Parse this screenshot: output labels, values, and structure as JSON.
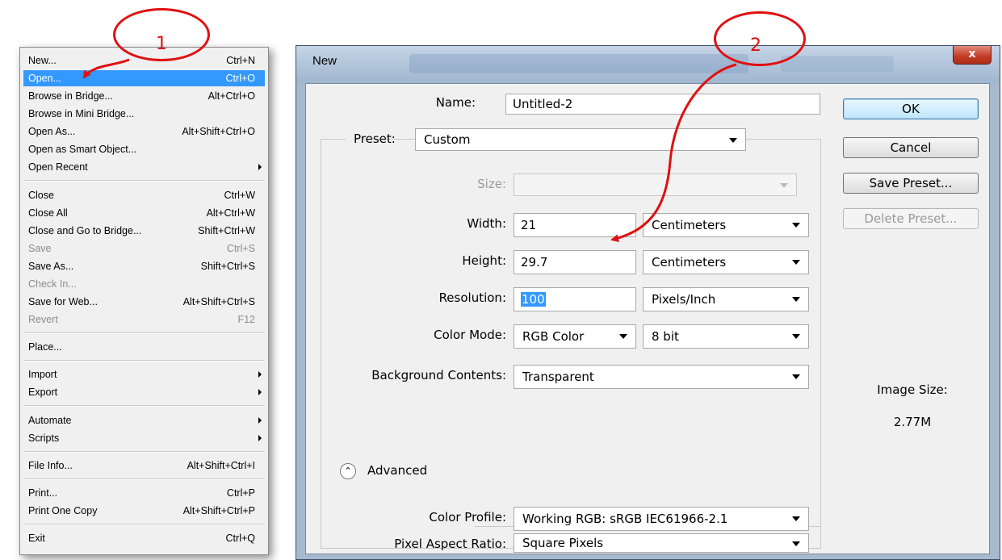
{
  "annotations": {
    "step1": "1",
    "step2": "2"
  },
  "file_menu": {
    "items": [
      {
        "label": "New...",
        "shortcut": "Ctrl+N"
      },
      {
        "label": "Open...",
        "shortcut": "Ctrl+O"
      },
      {
        "label": "Browse in Bridge...",
        "shortcut": "Alt+Ctrl+O"
      },
      {
        "label": "Browse in Mini Bridge...",
        "shortcut": ""
      },
      {
        "label": "Open As...",
        "shortcut": "Alt+Shift+Ctrl+O"
      },
      {
        "label": "Open as Smart Object...",
        "shortcut": ""
      },
      {
        "label": "Open Recent",
        "shortcut": ""
      },
      {
        "label": "Close",
        "shortcut": "Ctrl+W"
      },
      {
        "label": "Close All",
        "shortcut": "Alt+Ctrl+W"
      },
      {
        "label": "Close and Go to Bridge...",
        "shortcut": "Shift+Ctrl+W"
      },
      {
        "label": "Save",
        "shortcut": "Ctrl+S"
      },
      {
        "label": "Save As...",
        "shortcut": "Shift+Ctrl+S"
      },
      {
        "label": "Check In...",
        "shortcut": ""
      },
      {
        "label": "Save for Web...",
        "shortcut": "Alt+Shift+Ctrl+S"
      },
      {
        "label": "Revert",
        "shortcut": "F12"
      },
      {
        "label": "Place...",
        "shortcut": ""
      },
      {
        "label": "Import",
        "shortcut": ""
      },
      {
        "label": "Export",
        "shortcut": ""
      },
      {
        "label": "Automate",
        "shortcut": ""
      },
      {
        "label": "Scripts",
        "shortcut": ""
      },
      {
        "label": "File Info...",
        "shortcut": "Alt+Shift+Ctrl+I"
      },
      {
        "label": "Print...",
        "shortcut": "Ctrl+P"
      },
      {
        "label": "Print One Copy",
        "shortcut": "Alt+Shift+Ctrl+P"
      },
      {
        "label": "Exit",
        "shortcut": "Ctrl+Q"
      }
    ]
  },
  "dialog": {
    "title": "New",
    "close_label": "x",
    "name_label": "Name:",
    "name_value": "Untitled-2",
    "preset_label": "Preset:",
    "preset_value": "Custom",
    "size_label": "Size:",
    "size_value": "",
    "width_label": "Width:",
    "width_value": "21",
    "width_unit": "Centimeters",
    "height_label": "Height:",
    "height_value": "29.7",
    "height_unit": "Centimeters",
    "resolution_label": "Resolution:",
    "resolution_value": "100",
    "resolution_unit": "Pixels/Inch",
    "color_mode_label": "Color Mode:",
    "color_mode_value": "RGB Color",
    "bit_depth_value": "8 bit",
    "background_label": "Background Contents:",
    "background_value": "Transparent",
    "advanced_label": "Advanced",
    "color_profile_label": "Color Profile:",
    "color_profile_value": "Working RGB:  sRGB IEC61966-2.1",
    "pixel_aspect_label": "Pixel Aspect Ratio:",
    "pixel_aspect_value": "Square Pixels",
    "ok_label": "OK",
    "cancel_label": "Cancel",
    "save_preset_label": "Save Preset...",
    "delete_preset_label": "Delete Preset...",
    "image_size_label": "Image Size:",
    "image_size_value": "2.77M"
  },
  "colors": {
    "annotation": "#e01010",
    "menu_highlight": "#3399ff"
  }
}
